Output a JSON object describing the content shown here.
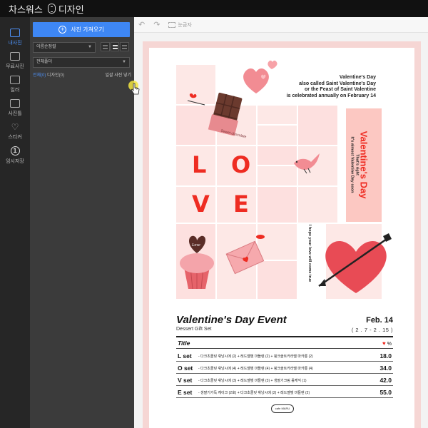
{
  "app": {
    "title_part1": "차스워스",
    "title_part2": "디자인",
    "title_icon": "capsule-icon"
  },
  "rail": {
    "items": [
      {
        "label": "내사진",
        "icon": "photo-icon",
        "active": true
      },
      {
        "label": "무료사진",
        "icon": "free-photo-icon",
        "active": false
      },
      {
        "label": "일러",
        "icon": "illust-icon",
        "active": false
      },
      {
        "label": "사진틀",
        "icon": "frame-icon",
        "active": false
      },
      {
        "label": "스티커",
        "icon": "heart-icon",
        "active": false
      },
      {
        "label": "임시저장",
        "icon": "temp-save-icon",
        "active": false
      }
    ]
  },
  "panel": {
    "upload_label": "사진 가져오기",
    "sort_value": "이름순정렬",
    "category_value": "전체폴더",
    "filter_all": "전체(0)",
    "filter_rest": "디자인(0)",
    "bulk_action": "일괄 사진 넣기"
  },
  "toolbar": {
    "undo_icon": "undo-icon",
    "redo_icon": "redo-icon",
    "grid_label": "눈금자"
  },
  "poster": {
    "heading": [
      "Valentine's Day",
      "also called Saint Valentine's Day",
      "or the Feast of Saint Valentine",
      "is celebrated annually on February 14"
    ],
    "love_letters": [
      "L",
      "O",
      "V",
      "E"
    ],
    "side_big": "Valentine's Day",
    "side_small_1": "That's right",
    "side_small_2": "It's almost Valentine Day soon",
    "hope_text": "I hope your love will come true",
    "chocolate_label": "Sweet chocolate",
    "cupcake_label": "Love",
    "event_title": "Valentine's Day Event",
    "event_subtitle": "Dessert Gift Set",
    "event_date": "Feb. 14",
    "event_range": "( 2 . 7  -  2 . 15 )",
    "table_title": "Title",
    "table_pct": "%",
    "rows": [
      {
        "name": "L set",
        "desc": "- 다크초콜릿 휘낭시에 (2) + 레드벨벳 마들렌 (2) + 핑크솔트카라멜 마카롱 (2)",
        "price": "18.0"
      },
      {
        "name": "O set",
        "desc": "- 다크초콜릿 휘낭시에 (4) + 레드벨벳 마들렌 (4) + 핑크솔트카라멜 마카롱 (4)",
        "price": "34.0"
      },
      {
        "name": "V set",
        "desc": "- 다크초콜릿 휘낭시에 (3) + 레드벨벳 마들렌 (3) + 생딸기크림 롤케익 (1)",
        "price": "42.0"
      },
      {
        "name": "E set",
        "desc": "- 생딸기가득 케이크 (2호) + 다크초콜릿 휘낭시에 (2) + 레드벨벳 마들렌 (2)",
        "price": "55.0"
      }
    ],
    "cafe_logo": "cafe MARU"
  },
  "colors": {
    "accent_blue": "#3e87f5",
    "love_red": "#ee2c22",
    "tile_pink": "#fde0df"
  }
}
